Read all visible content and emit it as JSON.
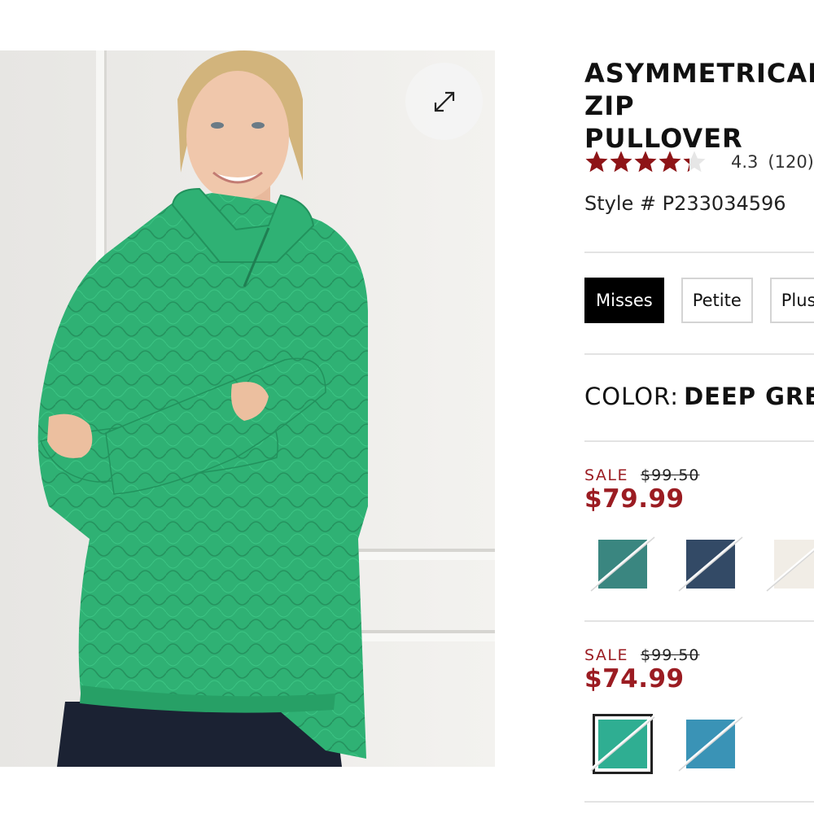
{
  "product": {
    "title": "ASYMMETRICAL ZIP\nPULLOVER",
    "rating": "4.3",
    "rating_value": 4.3,
    "review_count": "(120)",
    "style": "Style # P233034596"
  },
  "size_tabs": [
    {
      "label": "Misses",
      "active": true
    },
    {
      "label": "Petite",
      "active": false
    },
    {
      "label": "Plus",
      "active": false
    }
  ],
  "color": {
    "label": "COLOR:",
    "value": "DEEP GREEN"
  },
  "price_groups": [
    {
      "sale_label": "SALE",
      "original_price": "$99.50",
      "sale_price": "$79.99",
      "swatches": [
        {
          "name": "teal-swatch",
          "color": "#3a8680",
          "selected": false
        },
        {
          "name": "navy-swatch",
          "color": "#334a66",
          "selected": false
        },
        {
          "name": "ivory-swatch",
          "color": "#f1ede6",
          "selected": false
        }
      ]
    },
    {
      "sale_label": "SALE",
      "original_price": "$99.50",
      "sale_price": "$74.99",
      "swatches": [
        {
          "name": "deep-green-swatch",
          "color": "#2fae92",
          "selected": true
        },
        {
          "name": "blue-swatch",
          "color": "#3a93b6",
          "selected": false
        }
      ]
    }
  ],
  "icons": {
    "zoom": "expand-icon",
    "star": "star-icon"
  },
  "colors": {
    "sale_red": "#9b1c22",
    "star_red": "#8e1417",
    "sweater_green": "#2fb174"
  }
}
